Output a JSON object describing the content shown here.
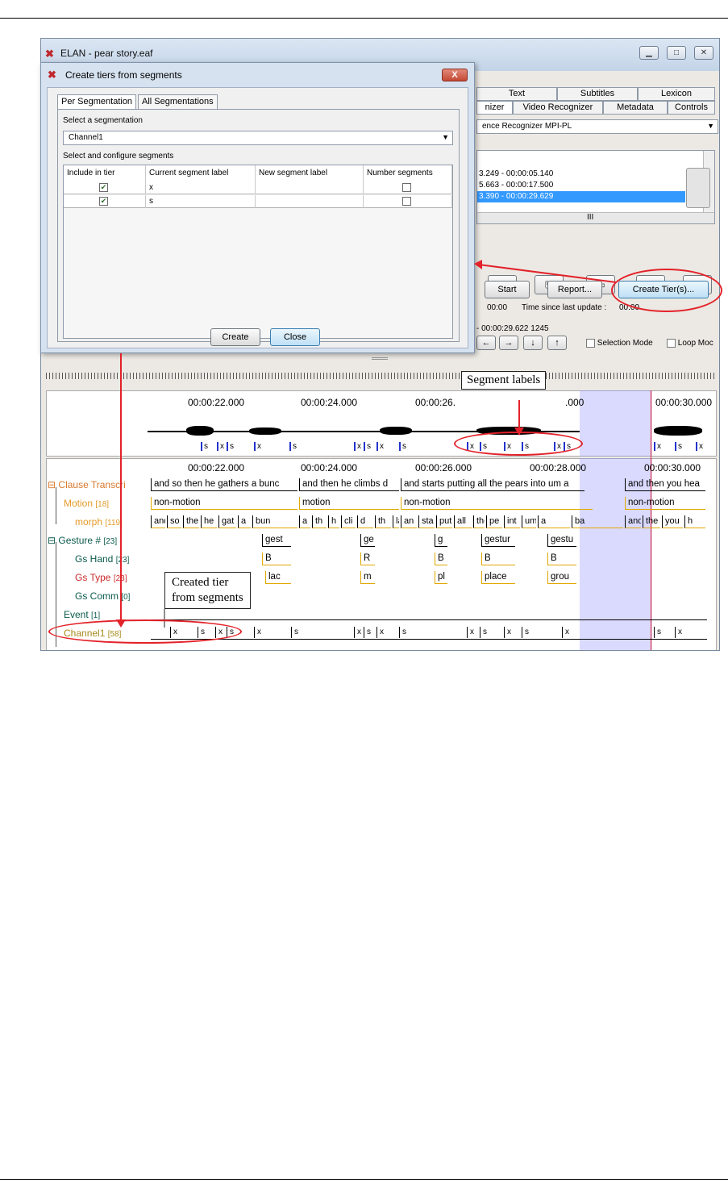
{
  "window": {
    "title": "ELAN - pear story.eaf"
  },
  "right_tabs": {
    "row1": [
      "Text",
      "Subtitles",
      "Lexicon"
    ],
    "row2": [
      "nizer",
      "Video Recognizer",
      "Metadata",
      "Controls"
    ]
  },
  "recognizer": {
    "selected": "ence Recognizer MPI-PL",
    "segments": [
      "3.249 - 00:00:05.140",
      "5.663 - 00:00:17.500",
      "3.390 - 00:00:29.629"
    ],
    "scroll_mark": "III",
    "start_label": "Start",
    "report_label": "Report...",
    "create_tiers_label": "Create Tier(s)...",
    "elapsed": "00:00",
    "since_update_label": "Time since last update :",
    "since_update_value": "00:00"
  },
  "selection_bar": {
    "time_text": "- 00:00:29.622  1245",
    "selection_mode": "Selection Mode",
    "loop_mode": "Loop Moc"
  },
  "dialog": {
    "title": "Create tiers from segments",
    "close_glyph": "X",
    "tabs": [
      "Per Segmentation",
      "All Segmentations"
    ],
    "select_segmentation_label": "Select a segmentation",
    "segmentation_value": "Channel1",
    "configure_label": "Select and configure segments",
    "columns": [
      "Include in tier",
      "Current segment label",
      "New segment label",
      "Number segments"
    ],
    "rows": [
      {
        "include": true,
        "current": "x",
        "new": "",
        "number": false
      },
      {
        "include": true,
        "current": "s",
        "new": "",
        "number": false
      }
    ],
    "create_label": "Create",
    "close_label": "Close"
  },
  "timeline": {
    "top_ticks": [
      "00:00:22.000",
      "00:00:24.000",
      "00:00:26.",
      ".000",
      "00:00:30.000"
    ],
    "wave_segments": [
      "s",
      "x",
      "s",
      "x",
      "s",
      "x",
      "s",
      "x",
      "s",
      "x",
      "s",
      "x",
      "s",
      "x",
      "s",
      "x",
      "s",
      "x"
    ],
    "ticks": [
      "00:00:22.000",
      "00:00:24.000",
      "00:00:26.000",
      "00:00:28.000",
      "00:00:30.000"
    ]
  },
  "tiers": [
    {
      "name": "Clause Transcri",
      "count": "",
      "color": "#d9782d"
    },
    {
      "name": "Motion",
      "count": "[18]",
      "color": "#e59a2a"
    },
    {
      "name": "morph",
      "count": "[119]",
      "color": "#e59a2a"
    },
    {
      "name": "Gesture #",
      "count": "[23]",
      "color": "#0b5b4b"
    },
    {
      "name": "Gs Hand",
      "count": "[23]",
      "color": "#0b5b4b"
    },
    {
      "name": "Gs Type",
      "count": "[23]",
      "color": "#cc2a2a"
    },
    {
      "name": "Gs Comm",
      "count": "[0]",
      "color": "#0b5b4b"
    },
    {
      "name": "Event",
      "count": "[1]",
      "color": "#0b5b4b"
    },
    {
      "name": "Channel1",
      "count": "[58]",
      "color": "#a88a1a"
    }
  ],
  "annotations": {
    "clause": [
      "and so then he gathers a bunc",
      "and then he climbs d",
      "and starts putting all the pears into um a",
      "and then you hea"
    ],
    "motion": [
      "non-motion",
      "motion",
      "non-motion",
      "non-motion"
    ],
    "morph": [
      "and",
      "so",
      "the",
      "he",
      "gat",
      "a",
      "bun",
      "a",
      "th",
      "h",
      "cli",
      "d",
      "th",
      "la",
      "an",
      "sta",
      "put",
      "all",
      "the",
      "pe",
      "int",
      "um",
      "a",
      "ba",
      "and",
      "the",
      "you",
      "h"
    ],
    "gesture": [
      "gest",
      "ge",
      "g",
      "gestur",
      "gestu"
    ],
    "gs_hand": [
      "B",
      "R",
      "B",
      "B",
      "B"
    ],
    "gs_type": [
      "lac",
      "m",
      "pl",
      "place",
      "grou"
    ],
    "channel1": [
      "x",
      "s",
      "x",
      "s",
      "x",
      "s",
      "x",
      "s",
      "x",
      "s",
      "x",
      "s",
      "x",
      "s",
      "x",
      "s",
      "x"
    ]
  },
  "callouts": {
    "segment_labels": "Segment labels",
    "created_tier": "Created tier\nfrom segments"
  }
}
